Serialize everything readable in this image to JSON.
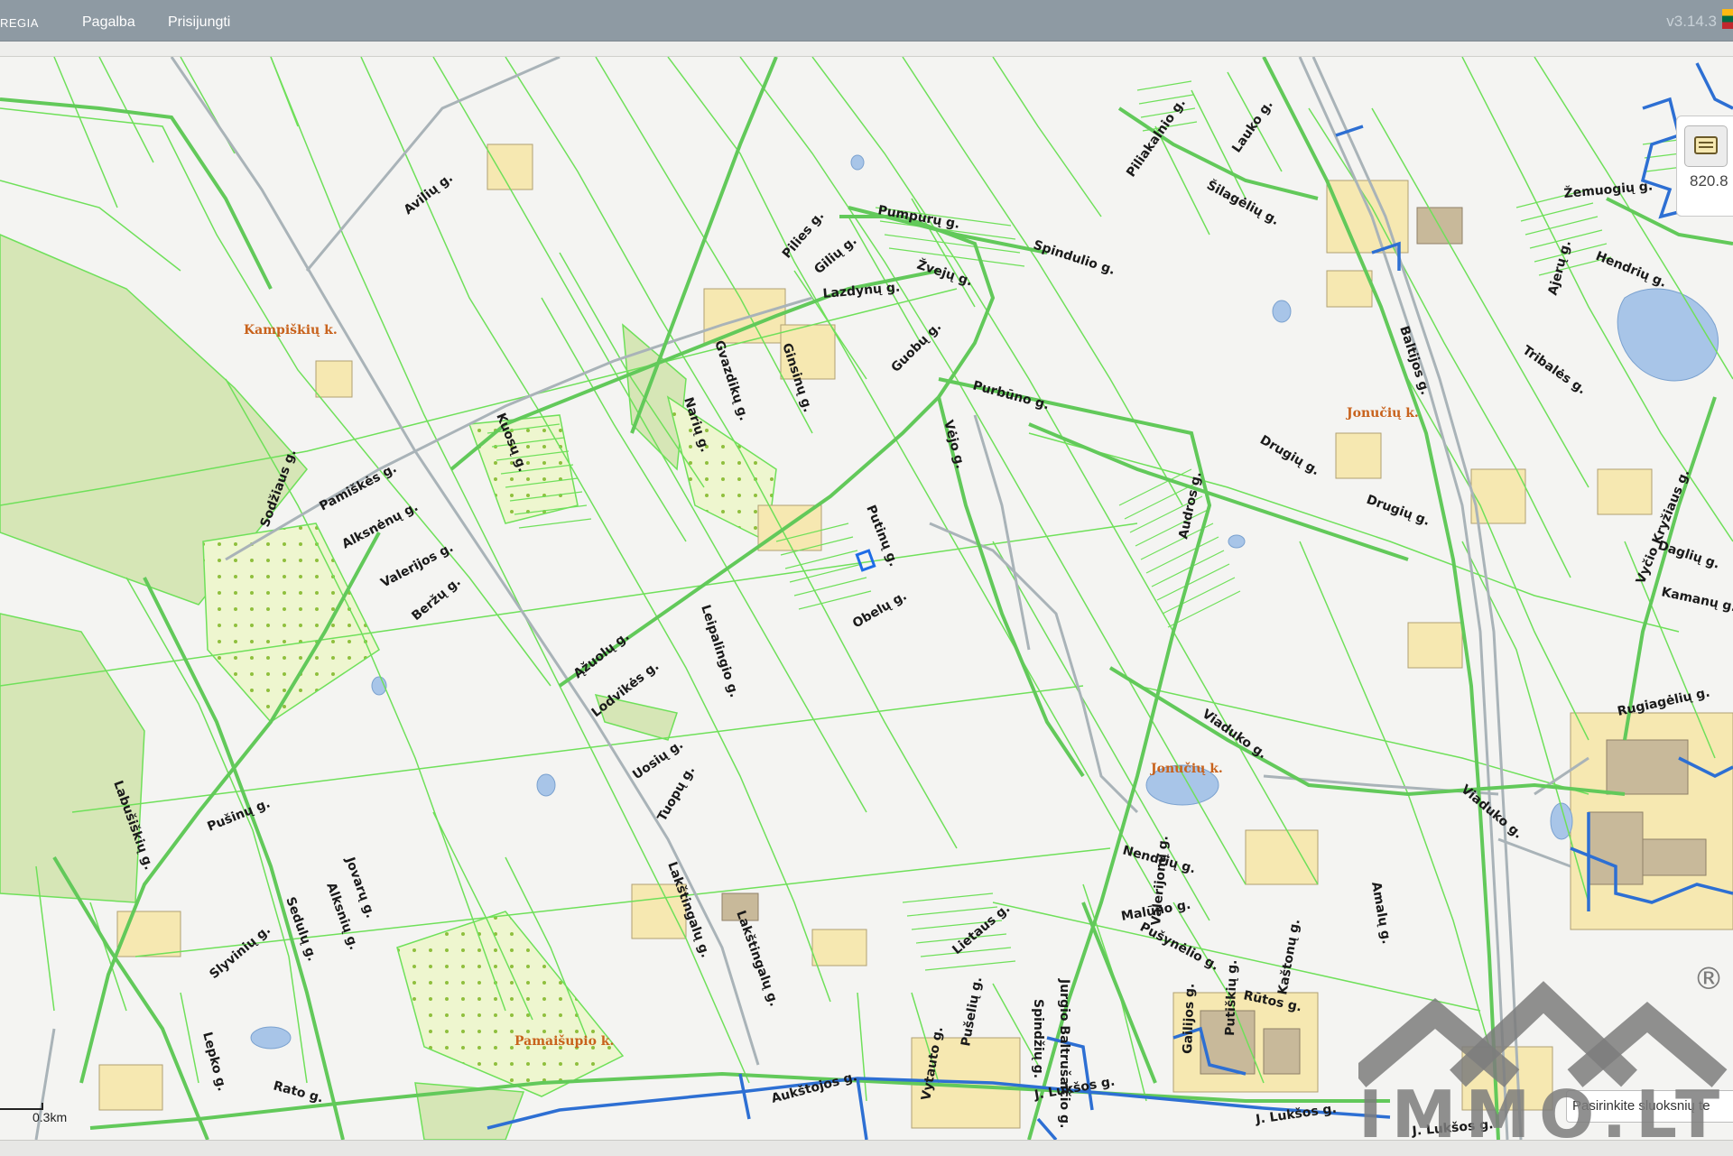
{
  "topbar": {
    "brand": "REGIA",
    "help": "Pagalba",
    "login": "Prisijungti",
    "version": "v3.14.3"
  },
  "tool": {
    "value": "820.8",
    "icon": "measure-tool-icon"
  },
  "scale": {
    "label": "0.3km"
  },
  "layer_hint": "Pasirinkite sluoksnių te",
  "watermark": {
    "text": "IMMO.LT",
    "symbol": "®"
  },
  "colors": {
    "parcel": "#6fe05a",
    "road": "#a9b3b8",
    "forest": "#d6e6b6",
    "built": "#f6e8b1",
    "water": "#a8c5e8",
    "selection": "#1e6ce6",
    "village": "#c8621c"
  },
  "map": {
    "villages": [
      "Kampiškių k.",
      "Jonučių k.",
      "Jonučių k.",
      "Pamaišupio k."
    ],
    "streets": [
      "Avilių g.",
      "Pumpurų g.",
      "Piliakalnio g.",
      "Šilagėlių g.",
      "Lauko g.",
      "Žemuogių g.",
      "Pilies g.",
      "Gilių g.",
      "Žvejų g.",
      "Spindulio g.",
      "Lazdynų g.",
      "Guobų g.",
      "Hendrių g.",
      "Ajerų g.",
      "Tribalės g.",
      "Baltijos g.",
      "Purbūno g.",
      "Gvazdikų g.",
      "Ginsinų g.",
      "Narių g.",
      "Kuosų g.",
      "Pamiškės g.",
      "Sodžiaus g.",
      "Alksnėnų g.",
      "Vėjo g.",
      "Drugių g.",
      "Drugių g.",
      "Audros g.",
      "Vyčio Kryžiaus g.",
      "Daglių g.",
      "Kamanų g.",
      "Putinų g.",
      "Obelų g.",
      "Beržų g.",
      "Valerijos g.",
      "Ąžuolų g.",
      "Lodvikės g.",
      "Leipalingio g.",
      "Viaduko g.",
      "Viaduko g.",
      "Rugiagėlių g.",
      "Uosių g.",
      "Tuopų g.",
      "Pušinų g.",
      "Labušiškių g.",
      "Jovarų g.",
      "Alksnių g.",
      "Sedulų g.",
      "Slyvinių g.",
      "Lakštingalų g.",
      "Lakštingalų g.",
      "Nendrių g.",
      "Malūno g.",
      "Pušynėlio g.",
      "Valerijonų g.",
      "Lietaus g.",
      "Amalų g.",
      "Jurgio Baltrušaičio g.",
      "Spindžių g.",
      "Gailijos g.",
      "Putiškių g.",
      "Kaštonų g.",
      "Rūtos g.",
      "J. Lukšos g.",
      "J. Lukšos g.",
      "J. Lukšos g.",
      "Aukštojos g.",
      "Lepko g.",
      "Rato g.",
      "Pušelių g.",
      "Vytauto g."
    ]
  }
}
